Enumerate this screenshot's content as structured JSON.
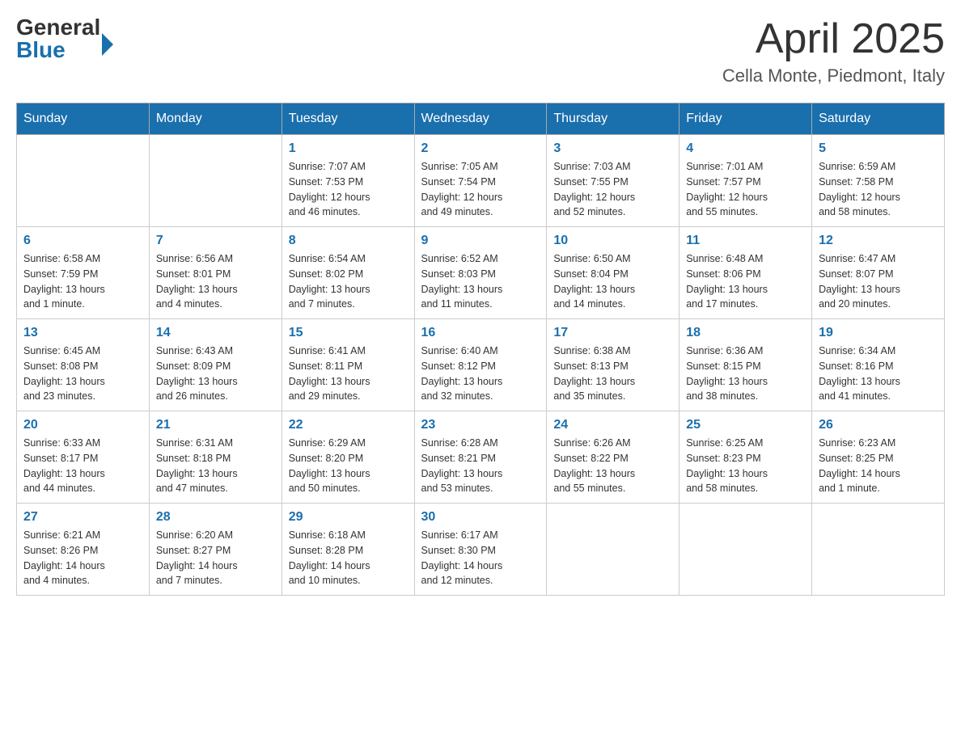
{
  "header": {
    "logo_general": "General",
    "logo_blue": "Blue",
    "month_title": "April 2025",
    "subtitle": "Cella Monte, Piedmont, Italy"
  },
  "weekdays": [
    "Sunday",
    "Monday",
    "Tuesday",
    "Wednesday",
    "Thursday",
    "Friday",
    "Saturday"
  ],
  "weeks": [
    [
      {
        "day": "",
        "info": ""
      },
      {
        "day": "",
        "info": ""
      },
      {
        "day": "1",
        "info": "Sunrise: 7:07 AM\nSunset: 7:53 PM\nDaylight: 12 hours\nand 46 minutes."
      },
      {
        "day": "2",
        "info": "Sunrise: 7:05 AM\nSunset: 7:54 PM\nDaylight: 12 hours\nand 49 minutes."
      },
      {
        "day": "3",
        "info": "Sunrise: 7:03 AM\nSunset: 7:55 PM\nDaylight: 12 hours\nand 52 minutes."
      },
      {
        "day": "4",
        "info": "Sunrise: 7:01 AM\nSunset: 7:57 PM\nDaylight: 12 hours\nand 55 minutes."
      },
      {
        "day": "5",
        "info": "Sunrise: 6:59 AM\nSunset: 7:58 PM\nDaylight: 12 hours\nand 58 minutes."
      }
    ],
    [
      {
        "day": "6",
        "info": "Sunrise: 6:58 AM\nSunset: 7:59 PM\nDaylight: 13 hours\nand 1 minute."
      },
      {
        "day": "7",
        "info": "Sunrise: 6:56 AM\nSunset: 8:01 PM\nDaylight: 13 hours\nand 4 minutes."
      },
      {
        "day": "8",
        "info": "Sunrise: 6:54 AM\nSunset: 8:02 PM\nDaylight: 13 hours\nand 7 minutes."
      },
      {
        "day": "9",
        "info": "Sunrise: 6:52 AM\nSunset: 8:03 PM\nDaylight: 13 hours\nand 11 minutes."
      },
      {
        "day": "10",
        "info": "Sunrise: 6:50 AM\nSunset: 8:04 PM\nDaylight: 13 hours\nand 14 minutes."
      },
      {
        "day": "11",
        "info": "Sunrise: 6:48 AM\nSunset: 8:06 PM\nDaylight: 13 hours\nand 17 minutes."
      },
      {
        "day": "12",
        "info": "Sunrise: 6:47 AM\nSunset: 8:07 PM\nDaylight: 13 hours\nand 20 minutes."
      }
    ],
    [
      {
        "day": "13",
        "info": "Sunrise: 6:45 AM\nSunset: 8:08 PM\nDaylight: 13 hours\nand 23 minutes."
      },
      {
        "day": "14",
        "info": "Sunrise: 6:43 AM\nSunset: 8:09 PM\nDaylight: 13 hours\nand 26 minutes."
      },
      {
        "day": "15",
        "info": "Sunrise: 6:41 AM\nSunset: 8:11 PM\nDaylight: 13 hours\nand 29 minutes."
      },
      {
        "day": "16",
        "info": "Sunrise: 6:40 AM\nSunset: 8:12 PM\nDaylight: 13 hours\nand 32 minutes."
      },
      {
        "day": "17",
        "info": "Sunrise: 6:38 AM\nSunset: 8:13 PM\nDaylight: 13 hours\nand 35 minutes."
      },
      {
        "day": "18",
        "info": "Sunrise: 6:36 AM\nSunset: 8:15 PM\nDaylight: 13 hours\nand 38 minutes."
      },
      {
        "day": "19",
        "info": "Sunrise: 6:34 AM\nSunset: 8:16 PM\nDaylight: 13 hours\nand 41 minutes."
      }
    ],
    [
      {
        "day": "20",
        "info": "Sunrise: 6:33 AM\nSunset: 8:17 PM\nDaylight: 13 hours\nand 44 minutes."
      },
      {
        "day": "21",
        "info": "Sunrise: 6:31 AM\nSunset: 8:18 PM\nDaylight: 13 hours\nand 47 minutes."
      },
      {
        "day": "22",
        "info": "Sunrise: 6:29 AM\nSunset: 8:20 PM\nDaylight: 13 hours\nand 50 minutes."
      },
      {
        "day": "23",
        "info": "Sunrise: 6:28 AM\nSunset: 8:21 PM\nDaylight: 13 hours\nand 53 minutes."
      },
      {
        "day": "24",
        "info": "Sunrise: 6:26 AM\nSunset: 8:22 PM\nDaylight: 13 hours\nand 55 minutes."
      },
      {
        "day": "25",
        "info": "Sunrise: 6:25 AM\nSunset: 8:23 PM\nDaylight: 13 hours\nand 58 minutes."
      },
      {
        "day": "26",
        "info": "Sunrise: 6:23 AM\nSunset: 8:25 PM\nDaylight: 14 hours\nand 1 minute."
      }
    ],
    [
      {
        "day": "27",
        "info": "Sunrise: 6:21 AM\nSunset: 8:26 PM\nDaylight: 14 hours\nand 4 minutes."
      },
      {
        "day": "28",
        "info": "Sunrise: 6:20 AM\nSunset: 8:27 PM\nDaylight: 14 hours\nand 7 minutes."
      },
      {
        "day": "29",
        "info": "Sunrise: 6:18 AM\nSunset: 8:28 PM\nDaylight: 14 hours\nand 10 minutes."
      },
      {
        "day": "30",
        "info": "Sunrise: 6:17 AM\nSunset: 8:30 PM\nDaylight: 14 hours\nand 12 minutes."
      },
      {
        "day": "",
        "info": ""
      },
      {
        "day": "",
        "info": ""
      },
      {
        "day": "",
        "info": ""
      }
    ]
  ]
}
